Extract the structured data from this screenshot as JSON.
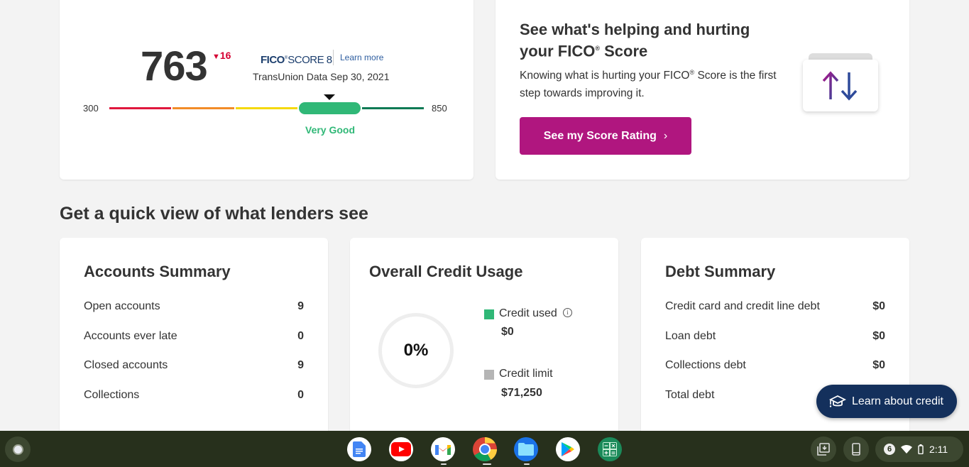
{
  "score_card": {
    "score": "763",
    "delta": "16",
    "delta_direction": "down",
    "fico_logo_bold": "FICO",
    "fico_logo_light": "SCORE 8",
    "learn_more": "Learn more",
    "data_source": "TransUnion Data Sep 30, 2021",
    "range_min": "300",
    "range_max": "850",
    "rating": "Very Good",
    "colors": {
      "poor": "#e0173d",
      "fair": "#f28c28",
      "good": "#f5d90a",
      "very_good": "#30b877",
      "exceptional": "#0e7a55",
      "delta": "#d50032"
    }
  },
  "promo_card": {
    "title_line1": "See what's helping and hurting",
    "title_line2_prefix": "your FICO",
    "title_line2_suffix": " Score",
    "body_prefix": "Knowing what is hurting your FICO",
    "body_suffix": " Score is the first step towards improving it.",
    "registered": "®",
    "button_label": "See my Score Rating",
    "button_chevron": "›",
    "icon": "up-down-arrows-icon",
    "button_color": "#b0167f"
  },
  "section_title": "Get a quick view of what lenders see",
  "accounts_summary": {
    "title": "Accounts Summary",
    "rows": [
      {
        "label": "Open accounts",
        "value": "9"
      },
      {
        "label": "Accounts ever late",
        "value": "0"
      },
      {
        "label": "Closed accounts",
        "value": "9"
      },
      {
        "label": "Collections",
        "value": "0"
      }
    ]
  },
  "credit_usage": {
    "title": "Overall Credit Usage",
    "percent": "0%",
    "percent_value": 0,
    "used_label": "Credit used",
    "used_value": "$0",
    "used_color": "#30b877",
    "limit_label": "Credit limit",
    "limit_value": "$71,250",
    "limit_color": "#b5b5b5",
    "info_glyph": "i"
  },
  "debt_summary": {
    "title": "Debt Summary",
    "rows": [
      {
        "label": "Credit card and credit line debt",
        "value": "$0"
      },
      {
        "label": "Loan debt",
        "value": "$0"
      },
      {
        "label": "Collections debt",
        "value": "$0"
      },
      {
        "label": "Total debt",
        "value": ""
      }
    ]
  },
  "fab": {
    "label": "Learn about credit",
    "icon": "graduation-cap-icon",
    "color": "#14305c"
  },
  "shelf": {
    "apps": [
      {
        "name": "docs",
        "icon": "google-docs-icon",
        "running": false
      },
      {
        "name": "youtube",
        "icon": "youtube-icon",
        "running": false
      },
      {
        "name": "gmail",
        "icon": "gmail-icon",
        "running": true
      },
      {
        "name": "chrome",
        "icon": "chrome-icon",
        "running": true
      },
      {
        "name": "files",
        "icon": "files-icon",
        "running": true
      },
      {
        "name": "play-store",
        "icon": "play-store-icon",
        "running": false
      },
      {
        "name": "calculator",
        "icon": "calculator-icon",
        "running": false
      }
    ],
    "notification_count": "6",
    "time": "2:11"
  }
}
